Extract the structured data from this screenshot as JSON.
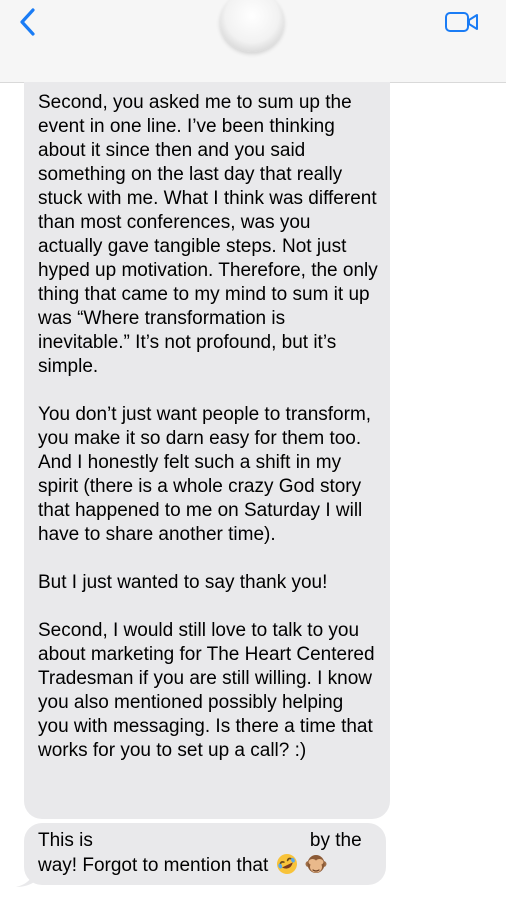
{
  "header": {
    "back_icon": "chevron-left-icon",
    "avatar_icon": "contact-avatar",
    "video_icon": "video-camera-icon",
    "accent_color": "#1a7cf5"
  },
  "messages": {
    "main_paragraphs": [
      "Second, you asked me to sum up the event in one line. I’ve been thinking about it since then and you said something on the last day that really stuck with me. What I think was different than most conferences, was you actually gave tangible steps. Not just hyped up motivation. Therefore, the only thing that came to my mind to sum it up was “Where transformation is inevitable.” It’s not profound, but it’s simple.",
      "You don’t just want people to transform, you make it so darn easy for them too. And I honestly felt such a shift in my spirit (there is a whole crazy God story that happened to me on Saturday I will have to share another time).",
      "But I just wanted to say thank you!",
      "Second, I would still love to talk to you about marketing for The Heart Centered Tradesman if you are still willing. I know you also mentioned possibly helping you with messaging. Is there a time that works for you to set up a call? :)"
    ],
    "last": {
      "part1": "This is",
      "part2": "by the",
      "line2": "way! Forgot to mention that",
      "emojis": [
        "rolling-on-floor-laughing-emoji",
        "see-no-evil-monkey-emoji"
      ]
    },
    "bubble_color": "#e9e9eb"
  }
}
